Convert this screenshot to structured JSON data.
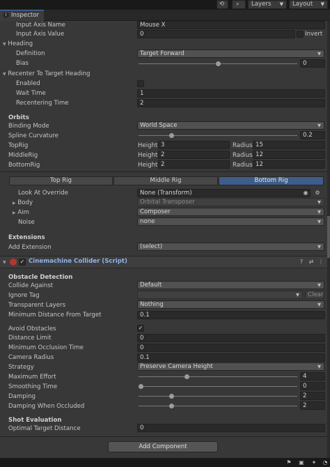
{
  "toolbar": {
    "history_icon": "history-icon",
    "search_icon": "search-icon",
    "layers_label": "Layers",
    "layout_label": "Layout"
  },
  "tab": {
    "title": "Inspector"
  },
  "input_axis": {
    "name_label": "Input Axis Name",
    "name_value": "Mouse X",
    "value_label": "Input Axis Value",
    "value": "0",
    "invert_label": "Invert"
  },
  "heading": {
    "title": "Heading",
    "definition_label": "Definition",
    "definition_value": "Target Forward",
    "bias_label": "Bias",
    "bias_value": "0",
    "bias_fraction": 0.5
  },
  "recenter": {
    "title": "Recenter To Target Heading",
    "enabled_label": "Enabled",
    "wait_label": "Wait Time",
    "wait_value": "1",
    "recentering_label": "Recentering Time",
    "recentering_value": "2"
  },
  "orbits": {
    "title": "Orbits",
    "binding_label": "Binding Mode",
    "binding_value": "World Space",
    "spline_label": "Spline Curvature",
    "spline_value": "0.2",
    "spline_fraction": 0.2,
    "height_label": "Height",
    "radius_label": "Radius",
    "rigs": [
      {
        "label": "TopRig",
        "height": "3",
        "radius": "15"
      },
      {
        "label": "MiddleRig",
        "height": "2",
        "radius": "12"
      },
      {
        "label": "BottomRig",
        "height": "2",
        "radius": "12"
      }
    ]
  },
  "rig_tabs": [
    "Top Rig",
    "Middle Rig",
    "Bottom Rig"
  ],
  "rig_props": {
    "lookat_label": "Look At Override",
    "lookat_value": "None (Transform)",
    "body_label": "Body",
    "body_value": "Orbital Transposer",
    "aim_label": "Aim",
    "aim_value": "Composer",
    "noise_label": "Noise",
    "noise_value": "none"
  },
  "extensions": {
    "title": "Extensions",
    "add_label": "Add Extension",
    "add_value": "(select)"
  },
  "component": {
    "title": "Cinemachine Collider (Script)"
  },
  "obstacle": {
    "title": "Obstacle Detection",
    "collide_label": "Collide Against",
    "collide_value": "Default",
    "ignore_label": "Ignore Tag",
    "ignore_value": "",
    "clear_label": "Clear",
    "transparent_label": "Transparent Layers",
    "transparent_value": "Nothing",
    "min_dist_label": "Minimum Distance From Target",
    "min_dist_value": "0.1",
    "avoid_label": "Avoid Obstacles",
    "distance_limit_label": "Distance Limit",
    "distance_limit_value": "0",
    "min_occl_label": "Minimum Occlusion Time",
    "min_occl_value": "0",
    "cam_radius_label": "Camera Radius",
    "cam_radius_value": "0.1",
    "strategy_label": "Strategy",
    "strategy_value": "Preserve Camera Height",
    "max_effort_label": "Maximum Effort",
    "max_effort_value": "4",
    "max_effort_fraction": 0.3,
    "smoothing_label": "Smoothing Time",
    "smoothing_value": "0",
    "smoothing_fraction": 0.0,
    "damping_label": "Damping",
    "damping_value": "2",
    "damping_fraction": 0.2,
    "damping_occ_label": "Damping When Occluded",
    "damping_occ_value": "2",
    "damping_occ_fraction": 0.2
  },
  "shot": {
    "title": "Shot Evaluation",
    "optimal_label": "Optimal Target Distance",
    "optimal_value": "0"
  },
  "add_component": "Add Component"
}
